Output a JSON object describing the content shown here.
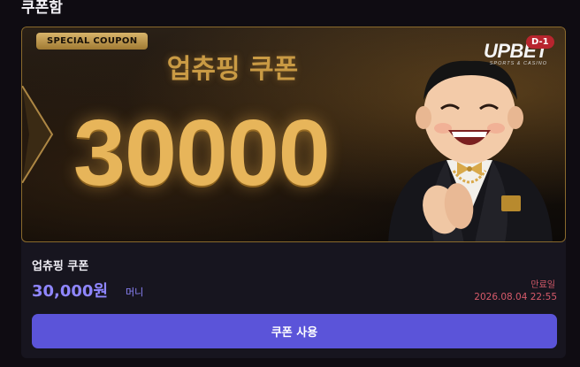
{
  "section": {
    "title": "쿠폰함"
  },
  "banner": {
    "badge": "SPECIAL COUPON",
    "subtitle": "업츄핑 쿠폰",
    "amount": "30000",
    "logo_main": "UPBET",
    "logo_sub": "SPORTS & CASINO",
    "dday": "D-1"
  },
  "coupon": {
    "title": "업츄핑 쿠폰",
    "amount": "30,000원",
    "unit": "머니",
    "expiry_label": "만료일",
    "expiry_date": "2026.08.04 22:55",
    "button_label": "쿠폰 사용"
  },
  "colors": {
    "accent": "#5b54d9",
    "amount": "#8f86ff",
    "gold": "#e7b55a",
    "expiry": "#d65a6a",
    "dday": "#b8252e"
  }
}
